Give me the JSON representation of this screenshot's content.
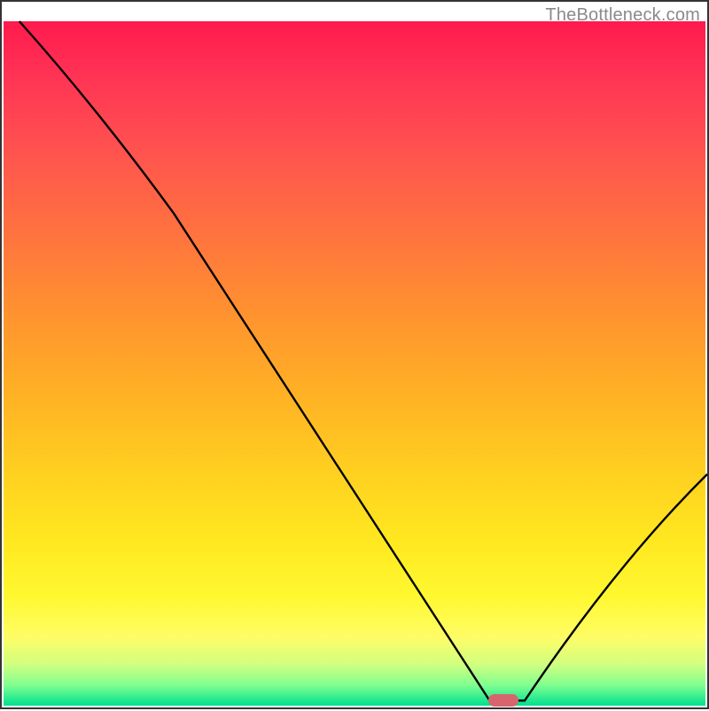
{
  "watermark": "TheBottleneck.com",
  "chart_data": {
    "type": "line",
    "title": "",
    "xlabel": "",
    "ylabel": "",
    "xlim": [
      0,
      100
    ],
    "ylim": [
      0,
      100
    ],
    "x": [
      2,
      24,
      69,
      74,
      100
    ],
    "values": [
      100,
      72,
      1,
      1,
      34
    ],
    "marker": {
      "x": 71,
      "y": 1
    },
    "gradient_stops": [
      {
        "pos": 0,
        "color": "#ff1a4d"
      },
      {
        "pos": 18,
        "color": "#ff5050"
      },
      {
        "pos": 42,
        "color": "#ff9030"
      },
      {
        "pos": 66,
        "color": "#ffd020"
      },
      {
        "pos": 84,
        "color": "#fff830"
      },
      {
        "pos": 94,
        "color": "#d0ff80"
      },
      {
        "pos": 100,
        "color": "#00e090"
      }
    ]
  }
}
